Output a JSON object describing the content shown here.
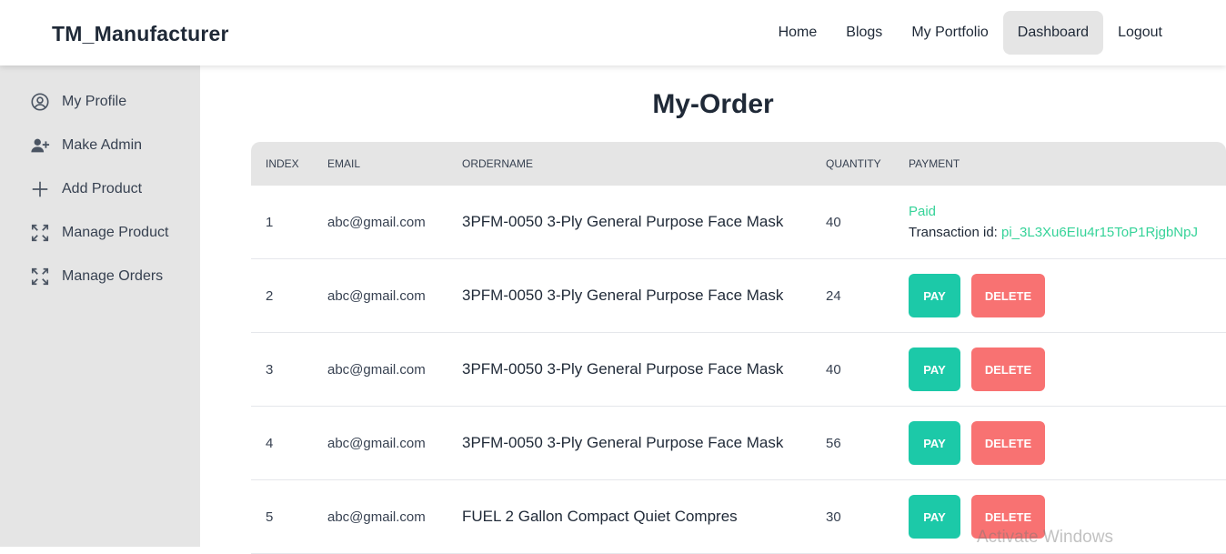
{
  "brand": "TM_Manufacturer",
  "nav": {
    "home": "Home",
    "blogs": "Blogs",
    "portfolio": "My Portfolio",
    "dashboard": "Dashboard",
    "logout": "Logout"
  },
  "sidebar": {
    "items": [
      {
        "label": "My Profile",
        "icon": "user-circle-icon"
      },
      {
        "label": "Make Admin",
        "icon": "user-add-icon"
      },
      {
        "label": "Add Product",
        "icon": "plus-icon"
      },
      {
        "label": "Manage Product",
        "icon": "expand-icon"
      },
      {
        "label": "Manage Orders",
        "icon": "expand-icon"
      }
    ]
  },
  "page_title": "My-Order",
  "table": {
    "headers": [
      "INDEX",
      "EMAIL",
      "ORDERNAME",
      "QUANTITY",
      "PAYMENT"
    ],
    "rows": [
      {
        "index": "1",
        "email": "abc@gmail.com",
        "order": "3PFM-0050 3-Ply General Purpose Face Mask",
        "qty": "40",
        "paid": "Paid",
        "txn_label": "Transaction id: ",
        "txn_id": "pi_3L3Xu6EIu4r15ToP1RjgbNpJ"
      },
      {
        "index": "2",
        "email": "abc@gmail.com",
        "order": "3PFM-0050 3-Ply General Purpose Face Mask",
        "qty": "24",
        "pay": "PAY",
        "delete": "DELETE"
      },
      {
        "index": "3",
        "email": "abc@gmail.com",
        "order": "3PFM-0050 3-Ply General Purpose Face Mask",
        "qty": "40",
        "pay": "PAY",
        "delete": "DELETE"
      },
      {
        "index": "4",
        "email": "abc@gmail.com",
        "order": "3PFM-0050 3-Ply General Purpose Face Mask",
        "qty": "56",
        "pay": "PAY",
        "delete": "DELETE"
      },
      {
        "index": "5",
        "email": "abc@gmail.com",
        "order": "FUEL 2 Gallon Compact Quiet Compres",
        "qty": "30",
        "pay": "PAY",
        "delete": "DELETE"
      }
    ]
  },
  "watermark": "Activate Windows",
  "colors": {
    "success": "#36d399",
    "pay": "#1cc9a8",
    "delete": "#f87272",
    "sidebar_bg": "#e5e5e5"
  }
}
